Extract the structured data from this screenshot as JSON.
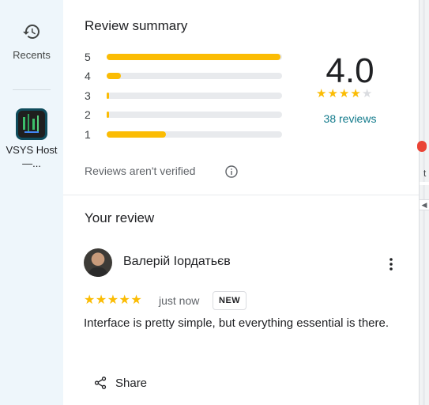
{
  "rail": {
    "recents_label": "Recents",
    "recent_place_label": "VSYS Host —..."
  },
  "summary": {
    "title": "Review summary",
    "bars": [
      {
        "stars": "5",
        "fraction": 0.99
      },
      {
        "stars": "4",
        "fraction": 0.08
      },
      {
        "stars": "3",
        "fraction": 0.0
      },
      {
        "stars": "2",
        "fraction": 0.0
      },
      {
        "stars": "1",
        "fraction": 0.34
      }
    ],
    "average": "4.0",
    "average_value": 4,
    "count_text": "38 reviews",
    "verified_text": "Reviews aren't verified"
  },
  "your_review": {
    "title": "Your review",
    "reviewer_name": "Валерій Іордатьєв",
    "rating": 5,
    "time": "just now",
    "badge": "NEW",
    "text": "Interface is pretty simple, but everything essential is there.",
    "share_label": "Share"
  },
  "map_edge": {
    "label": "t"
  },
  "colors": {
    "star": "#fbbc04",
    "link": "#137b8c",
    "rail_bg": "#eef6fb"
  }
}
